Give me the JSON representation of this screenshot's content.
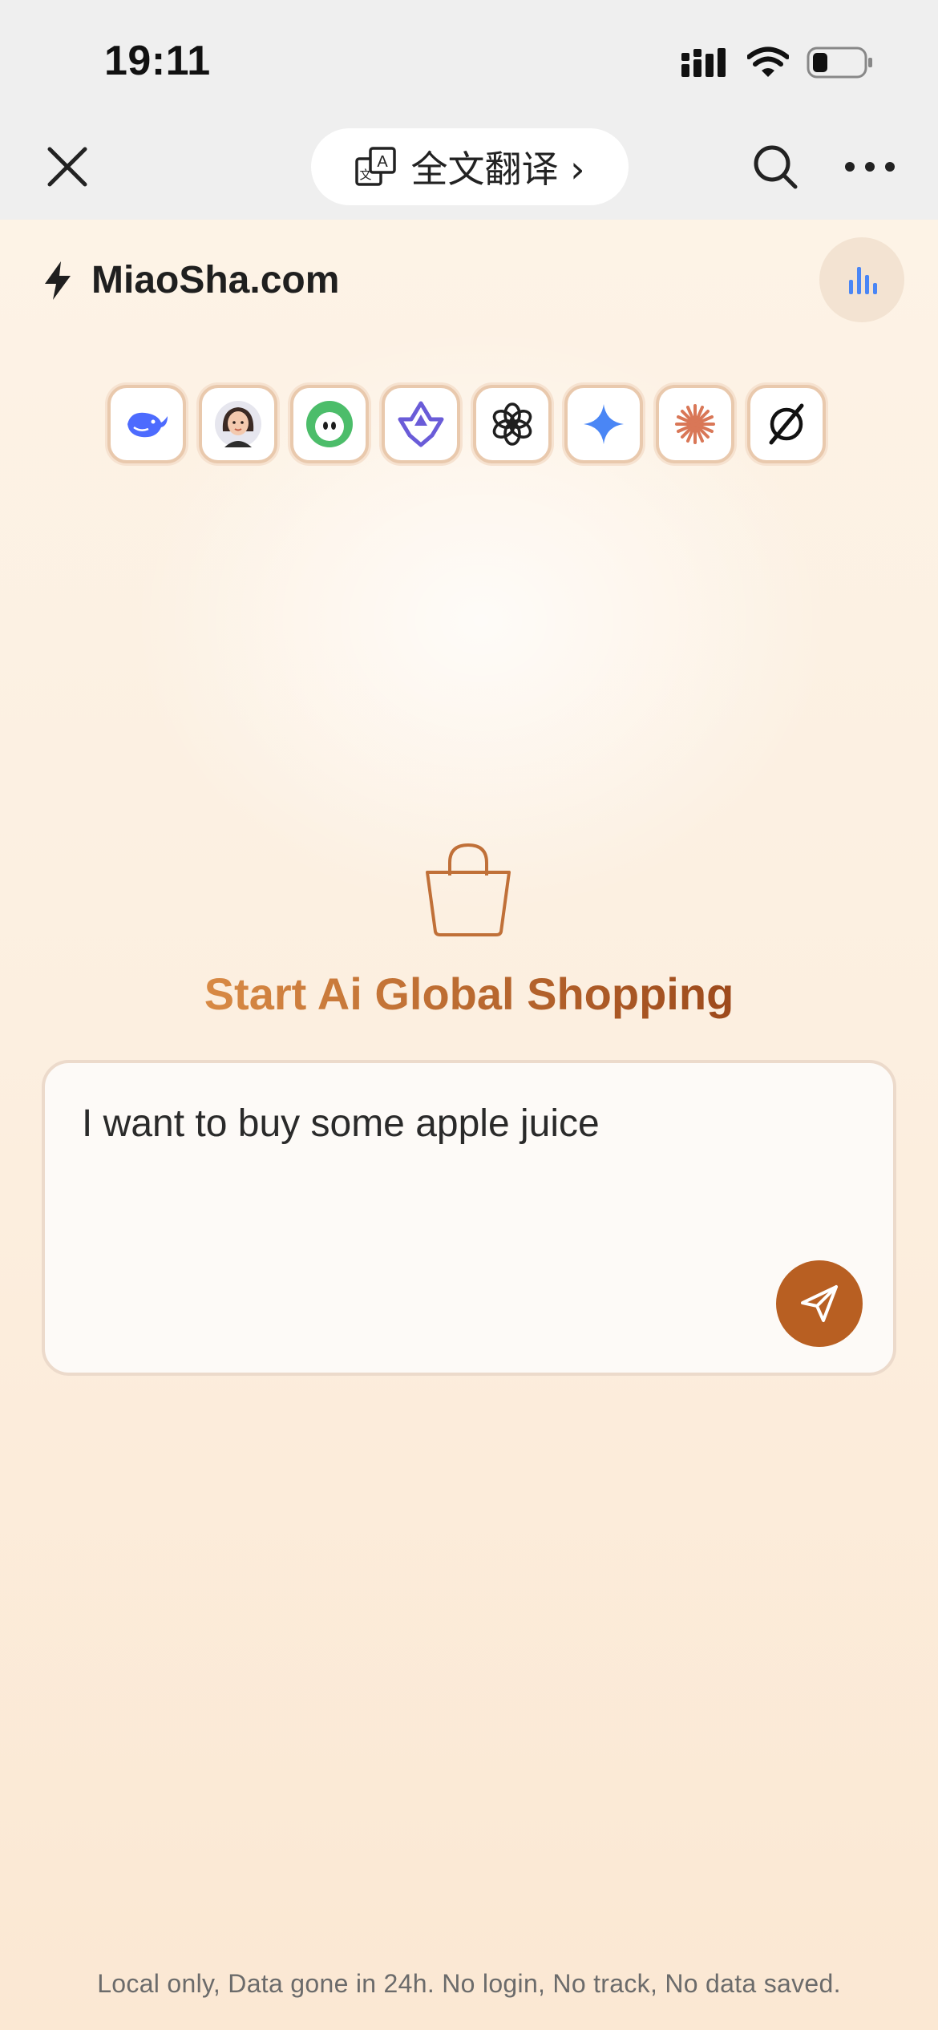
{
  "status": {
    "time": "19:11"
  },
  "browser": {
    "translate_label": "全文翻译 ›"
  },
  "brand": {
    "title": "MiaoSha.com"
  },
  "model_icons": [
    "deepseek-whale-icon",
    "avatar-girl-icon",
    "green-frog-icon",
    "qwen-star-icon",
    "openai-knot-icon",
    "gemini-sparkle-icon",
    "claude-burst-icon",
    "grok-slash-icon"
  ],
  "hero": {
    "title": "Start Ai Global Shopping"
  },
  "composer": {
    "value": "I want to buy some apple juice"
  },
  "footer": {
    "note": "Local only, Data gone in 24h. No login, No track, No data saved."
  },
  "colors": {
    "accent": "#b85f22",
    "title_start": "#d88a45",
    "title_end": "#9d4a1c",
    "gemini": "#4a86f5"
  }
}
